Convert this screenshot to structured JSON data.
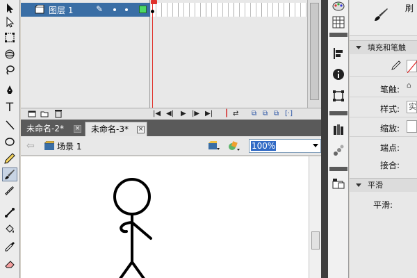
{
  "timeline": {
    "layer_name": "图层 1",
    "pencil": "✎",
    "controls": [
      "|◀",
      "◀|",
      "▶",
      "|▶",
      "▶|",
      "⟲",
      "⇄",
      "⧉",
      "⧉",
      "⧉",
      "[·]"
    ]
  },
  "doc_tabs": [
    {
      "label": "未命名-2*",
      "close": "×"
    },
    {
      "label": "未命名-3*",
      "close": "×"
    }
  ],
  "editbar": {
    "back": "⇦",
    "scene": "场景 1",
    "zoom": "100%"
  },
  "props": {
    "tool_title": "刷",
    "section_fill": "填充和笔触",
    "brush_label": "笔触:",
    "style_label": "样式:",
    "style_value": "实",
    "scale_label": "缩放:",
    "cap_label": "端点:",
    "join_label": "接合:",
    "section_smooth": "平滑",
    "smooth_label": "平滑:"
  },
  "tools": [
    {
      "icon": "selection-arrow-icon",
      "glyph": "➤"
    },
    {
      "icon": "subselection-arrow-icon",
      "glyph": "↖"
    },
    {
      "icon": "free-transform-icon",
      "glyph": "⛶"
    },
    {
      "icon": "3d-rotation-icon",
      "glyph": "◉"
    },
    {
      "icon": "lasso-icon",
      "glyph": "ϙ"
    },
    {
      "icon": "pen-icon",
      "glyph": "✒"
    },
    {
      "icon": "text-icon",
      "glyph": "T"
    },
    {
      "icon": "line-icon",
      "glyph": "╲"
    },
    {
      "icon": "oval-icon",
      "glyph": "◯"
    },
    {
      "icon": "pencil-icon",
      "glyph": "✎"
    },
    {
      "icon": "brush-icon",
      "glyph": "🖌"
    },
    {
      "icon": "deco-icon",
      "glyph": "✿"
    },
    {
      "icon": "bone-icon",
      "glyph": "⚲"
    },
    {
      "icon": "paint-bucket-icon",
      "glyph": "⛾"
    },
    {
      "icon": "eyedropper-icon",
      "glyph": "⌿"
    },
    {
      "icon": "eraser-icon",
      "glyph": "▱"
    }
  ],
  "colors": {
    "layer_selected": "#3a6ea5",
    "playhead": "#e0302a",
    "zoom_highlight": "#316ac5",
    "panel_dark": "#3e3e3e"
  }
}
